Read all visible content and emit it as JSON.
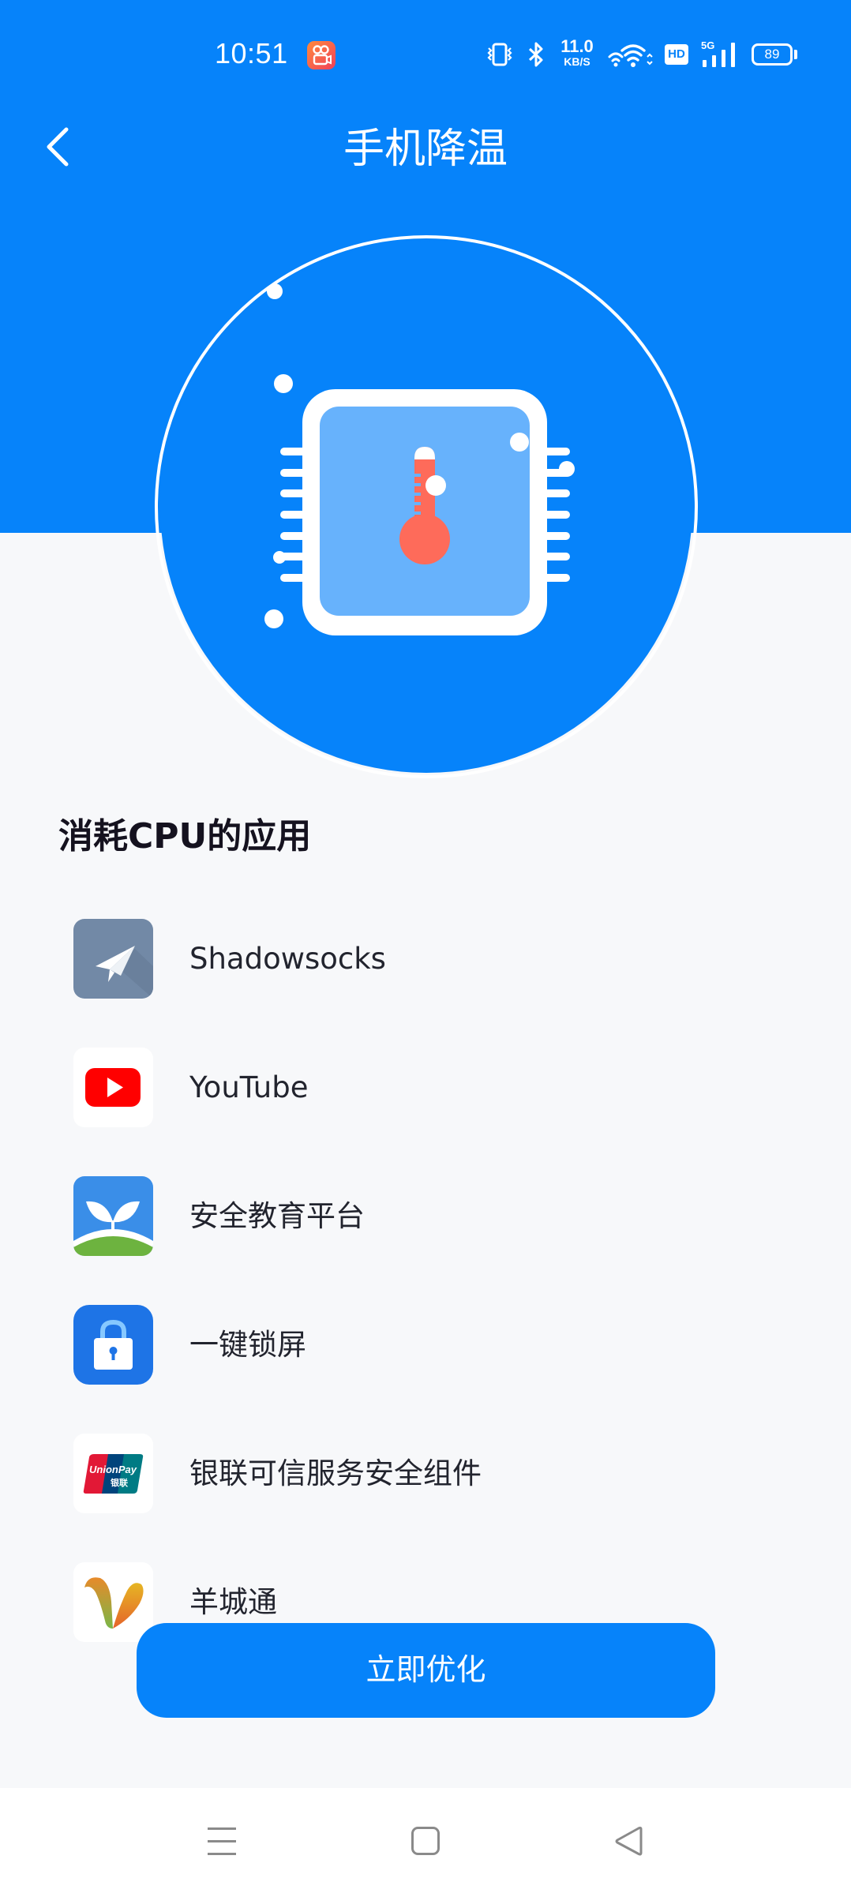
{
  "status_bar": {
    "time": "10:51",
    "notification_app_icon": "kuaishou-app-icon",
    "icons": [
      "vibrate-icon",
      "bluetooth-icon",
      "network-speed",
      "wifi-icon",
      "hd-icon",
      "5g-signal-icon",
      "battery-icon"
    ],
    "net_speed_value": "11.0",
    "net_speed_unit": "KB/S",
    "hd_label": "HD",
    "network_type": "5G",
    "battery_level": "89"
  },
  "header": {
    "title": "手机降温",
    "back_icon": "chevron-left-icon"
  },
  "colors": {
    "primary": "#0683fa",
    "background": "#f7f8fa",
    "chip_inner": "#67b2fc",
    "thermometer": "#fe6b5a",
    "text_primary": "#15121f"
  },
  "hero": {
    "icon": "cpu-thermometer-icon"
  },
  "section": {
    "title": "消耗CPU的应用"
  },
  "apps": [
    {
      "name": "Shadowsocks",
      "icon": "shadowsocks-icon"
    },
    {
      "name": "YouTube",
      "icon": "youtube-icon"
    },
    {
      "name": "安全教育平台",
      "icon": "safety-education-icon"
    },
    {
      "name": "一键锁屏",
      "icon": "lock-screen-icon"
    },
    {
      "name": "银联可信服务安全组件",
      "icon": "unionpay-icon"
    },
    {
      "name": "羊城通",
      "icon": "yangchengtong-icon"
    }
  ],
  "action": {
    "optimize_label": "立即优化"
  },
  "system_nav": {
    "recents": "menu-icon",
    "home": "home-icon",
    "back": "back-triangle-icon"
  }
}
